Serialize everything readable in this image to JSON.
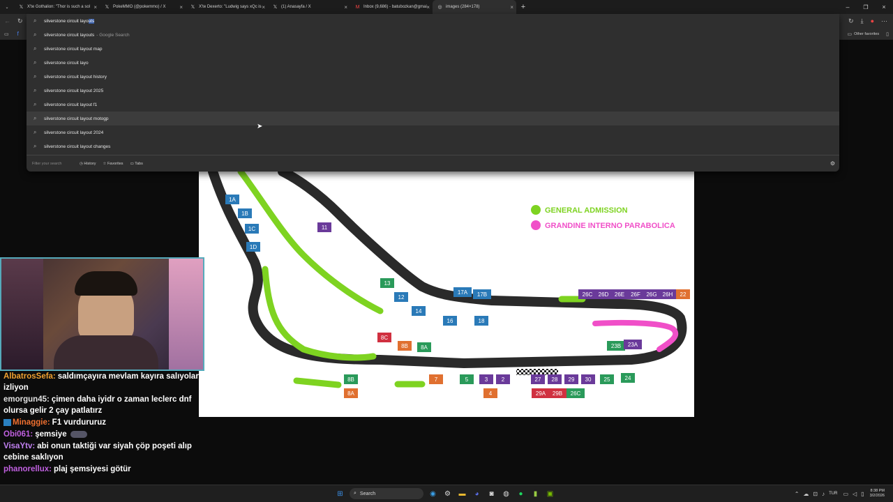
{
  "tabs": [
    {
      "title": "X'te Gothalion: \"Thor is such a sol",
      "icon": "x-logo-icon"
    },
    {
      "title": "PokeMMO (@pokemmo) / X",
      "icon": "x-logo-icon"
    },
    {
      "title": "X'te Dexerto: \"Ludwig says xQc is",
      "icon": "x-logo-icon"
    },
    {
      "title": "(1) Anasayfa / X",
      "icon": "x-logo-icon"
    },
    {
      "title": "Inbox (9,686) - batubozkan@gmai",
      "icon": "gmail-icon"
    },
    {
      "title": "images (284×178)",
      "icon": "globe-icon"
    }
  ],
  "omnibox": {
    "typed": "silverstone circuit layo",
    "autocomplete": "uts",
    "suggestions": [
      {
        "text": "silverstone circuit layouts",
        "suffix": "- Google Search"
      },
      {
        "text": "silverstone circuit layout map"
      },
      {
        "text": "silverstone circuit layo"
      },
      {
        "text": "silverstone circuit layout history"
      },
      {
        "text": "silverstone circuit layout 2025"
      },
      {
        "text": "silverstone circuit layout f1"
      },
      {
        "text": "silverstone circuit layout motogp"
      },
      {
        "text": "silverstone circuit layout 2024"
      },
      {
        "text": "silverstone circuit layout changes"
      }
    ],
    "filter_placeholder": "Filter your search",
    "footer": {
      "history": "History",
      "favorites": "Favorites",
      "tabs": "Tabs"
    }
  },
  "bookmarks": {
    "other": "Other favorites"
  },
  "track_map": {
    "legend": [
      {
        "label": "GENERAL ADMISSION",
        "color": "#7ed321"
      },
      {
        "label": "GRANDINE INTERNO PARABOLICA",
        "color": "#f04fc8"
      }
    ],
    "stands": [
      "1A",
      "1B",
      "1C",
      "1D",
      "11",
      "13",
      "12",
      "14",
      "17A",
      "17B",
      "16",
      "18",
      "8C",
      "8B",
      "8A",
      "26C",
      "26D",
      "26E",
      "26F",
      "26G",
      "26H",
      "22",
      "23B",
      "23A",
      "8B",
      "7",
      "5",
      "3",
      "2",
      "27",
      "28",
      "29",
      "30",
      "25",
      "24",
      "8A",
      "4",
      "29A",
      "29B",
      "26C"
    ]
  },
  "chat": [
    {
      "user": "AlbatrosSefa:",
      "color": "#f0a030",
      "text": "saldımçayıra mevlam kayıra salıyolar izliyon"
    },
    {
      "user": "emorgun45:",
      "color": "#e0e0e0",
      "text": "çimen daha iyidr o zaman leclerc dnf olursa gelir 2 çay patlatırz"
    },
    {
      "user": "Minaggie:",
      "color": "#f07030",
      "text": "F1 vurdururuz"
    },
    {
      "user": "Obi061:",
      "color": "#c060e0",
      "text": "şemsiye"
    },
    {
      "user": "VisaYtv:",
      "color": "#c080f0",
      "text": "abi onun taktiği var siyah çöp poşeti alıp cebine saklıyon"
    },
    {
      "user": "phanorellux:",
      "color": "#c060e0",
      "text": "plaj şemsiyesi götür"
    }
  ],
  "taskbar": {
    "search": "Search",
    "lang": "TUR",
    "time": "8:38 PM",
    "date": "3/2/2026"
  }
}
